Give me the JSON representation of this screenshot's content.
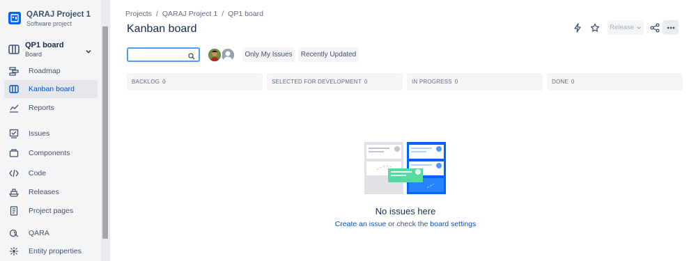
{
  "project": {
    "name": "QARAJ Project 1",
    "type": "Software project"
  },
  "board_selector": {
    "name": "QP1 board",
    "subtitle": "Board"
  },
  "sidebar": {
    "items": [
      {
        "label": "Roadmap",
        "icon": "roadmap-icon",
        "active": false
      },
      {
        "label": "Kanban board",
        "icon": "board-icon",
        "active": true
      },
      {
        "label": "Reports",
        "icon": "reports-icon",
        "active": false
      },
      {
        "label": "Issues",
        "icon": "issues-icon",
        "active": false
      },
      {
        "label": "Components",
        "icon": "components-icon",
        "active": false
      },
      {
        "label": "Code",
        "icon": "code-icon",
        "active": false
      },
      {
        "label": "Releases",
        "icon": "releases-icon",
        "active": false
      },
      {
        "label": "Project pages",
        "icon": "pages-icon",
        "active": false
      },
      {
        "label": "QARA",
        "icon": "qara-icon",
        "active": false
      },
      {
        "label": "Entity properties",
        "icon": "entity-icon",
        "active": false
      }
    ]
  },
  "breadcrumb": [
    "Projects",
    "QARAJ Project 1",
    "QP1 board"
  ],
  "page_title": "Kanban board",
  "header_actions": {
    "release_label": "Release"
  },
  "search": {
    "value": "",
    "placeholder": ""
  },
  "filters": [
    "Only My Issues",
    "Recently Updated"
  ],
  "columns": [
    {
      "name": "BACKLOG",
      "count": "0"
    },
    {
      "name": "SELECTED FOR DEVELOPMENT",
      "count": "0"
    },
    {
      "name": "IN PROGRESS",
      "count": "0"
    },
    {
      "name": "DONE",
      "count": "0"
    }
  ],
  "empty_state": {
    "title": "No issues here",
    "link1": "Create an issue",
    "mid": " or check the ",
    "link2": "board settings"
  },
  "colors": {
    "accent": "#0052cc",
    "brand": "#0065ff",
    "focus": "#4c9aff",
    "sidebar_bg": "#f4f5f7"
  }
}
